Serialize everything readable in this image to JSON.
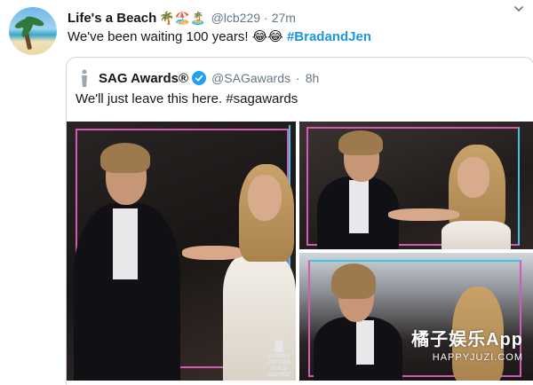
{
  "tweet": {
    "display_name": "Life's a Beach",
    "name_emojis": "🌴🏖️🏝️",
    "handle": "@lcb229",
    "separator": "·",
    "time": "27m",
    "text": "We've been waiting 100 years! ",
    "text_emojis": "😂😂",
    "hashtag": "#BradandJen"
  },
  "quote": {
    "display_name": "SAG Awards®",
    "handle": "@SAGawards",
    "separator": "·",
    "time": "8h",
    "text": "We'll just leave this here. #sagawards"
  },
  "photo_marks": {
    "sag_logo_text": "SCREEN ACTORS GUILD AWARDS"
  },
  "watermark": {
    "title": "橘子娱乐App",
    "url": "HAPPYJUZI.COM"
  },
  "colors": {
    "hashtag": "#1b95e0",
    "verified": "#1da1f2",
    "frame_magenta": "#d45bb5",
    "frame_cyan": "#3bc7e8"
  }
}
